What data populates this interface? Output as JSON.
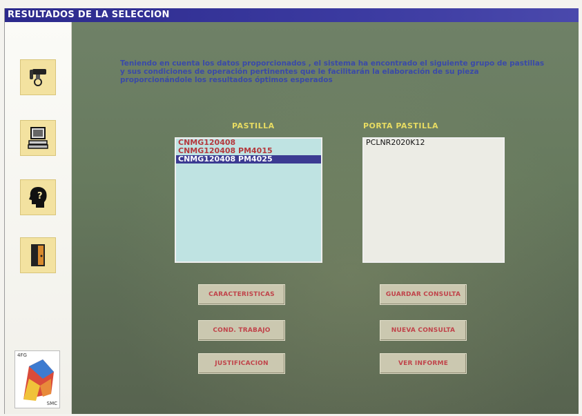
{
  "window": {
    "title": "RESULTADOS DE LA SELECCION"
  },
  "sidebar": {
    "buttons": [
      {
        "icon": "phone-icon"
      },
      {
        "icon": "computer-icon"
      },
      {
        "icon": "help-head-icon"
      },
      {
        "icon": "exit-door-icon"
      }
    ],
    "logo": {
      "text_top": "4FG",
      "text_bottom": "SMC"
    }
  },
  "main": {
    "intro_line1": "Teniendo en cuenta los datos proporcionados , el sistema ha encontrado el siguiente grupo de pastillas",
    "intro_line2": "y sus condiciones de operación pertinentes que le facilitarán la elaboración de su pieza",
    "intro_line3": "proporcionándole los resultados óptimos esperados",
    "pastilla_label": "PASTILLA",
    "portapastilla_label": "PORTA PASTILLA",
    "pastilla_items": [
      "CNMG120408",
      "CNMG120408 PM4015",
      "CNMG120408 PM4025"
    ],
    "pastilla_selected_index": 2,
    "portapastilla_items": [
      "PCLNR2020K12"
    ],
    "buttons": {
      "caracteristicas": "CARACTERISTICAS",
      "guardar_consulta": "GUARDAR CONSULTA",
      "cond_trabajo": "COND. TRABAJO",
      "nueva_consulta": "NUEVA CONSULTA",
      "justificacion": "JUSTIFICACION",
      "vers_informe": "VER INFORME"
    }
  },
  "colors": {
    "title_bar": "#2c2a8c",
    "background_green": "#677a5e",
    "intro_text": "#3a4aa8",
    "label_yellow": "#e8dc62",
    "button_text": "#c0434a",
    "list_selected": "#3b3b92"
  }
}
